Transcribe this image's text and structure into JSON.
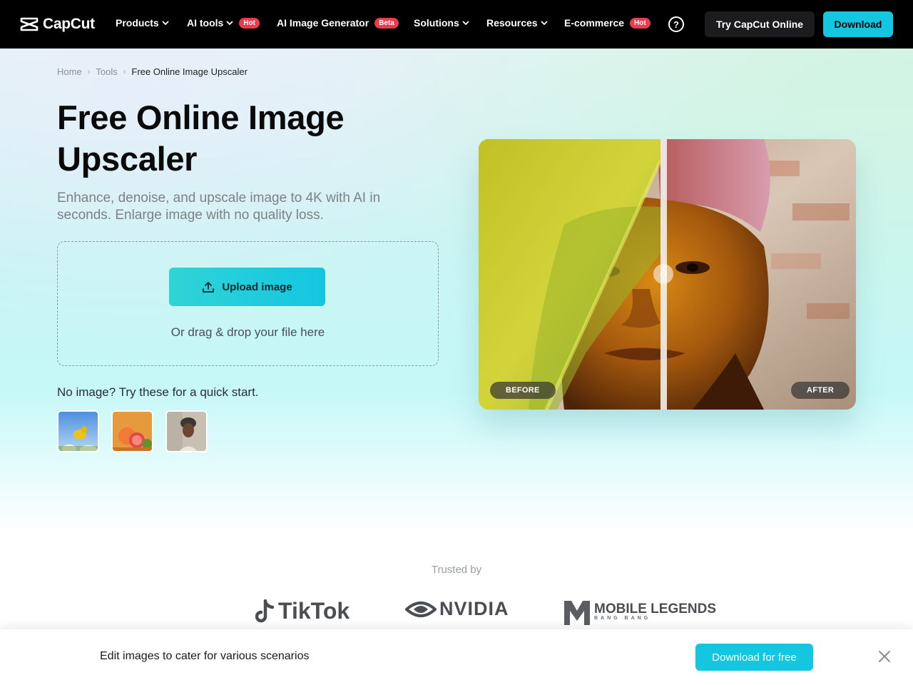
{
  "nav": {
    "logo_text": "CapCut",
    "items": [
      {
        "label": "Products",
        "dropdown": true,
        "badge": ""
      },
      {
        "label": "AI tools",
        "dropdown": true,
        "badge": "Hot"
      },
      {
        "label": "AI Image Generator",
        "dropdown": false,
        "badge": "Beta"
      },
      {
        "label": "Solutions",
        "dropdown": true,
        "badge": ""
      },
      {
        "label": "Resources",
        "dropdown": true,
        "badge": ""
      },
      {
        "label": "E-commerce",
        "dropdown": false,
        "badge": "Hot"
      }
    ],
    "help_icon": "question-circle-icon",
    "try_label": "Try CapCut Online",
    "download_label": "Download"
  },
  "breadcrumb": {
    "items": [
      "Home",
      "Tools",
      "Free Online Image Upscaler"
    ]
  },
  "hero": {
    "title": "Free Online Image Upscaler",
    "subtitle": "Enhance, denoise, and upscale image to 4K with AI in seconds. Enlarge image with no quality loss.",
    "upload_label": "Upload image",
    "drop_hint": "Or drag & drop your file here",
    "quick_start": "No image? Try these for a quick start.",
    "samples": [
      "sample-bird-flowers",
      "sample-fruits",
      "sample-portrait"
    ]
  },
  "compare": {
    "before_label": "BEFORE",
    "after_label": "AFTER"
  },
  "trusted": {
    "label": "Trusted by",
    "brands": [
      "TikTok",
      "NVIDIA",
      "MOBILE LEGENDS"
    ],
    "brand_sub": "BANG BANG"
  },
  "sticky": {
    "text": "Edit images to cater for various scenarios",
    "button": "Download for free"
  },
  "colors": {
    "accent": "#14c6e0",
    "badge": "#ee3a4a",
    "nav_bg": "#000000"
  }
}
